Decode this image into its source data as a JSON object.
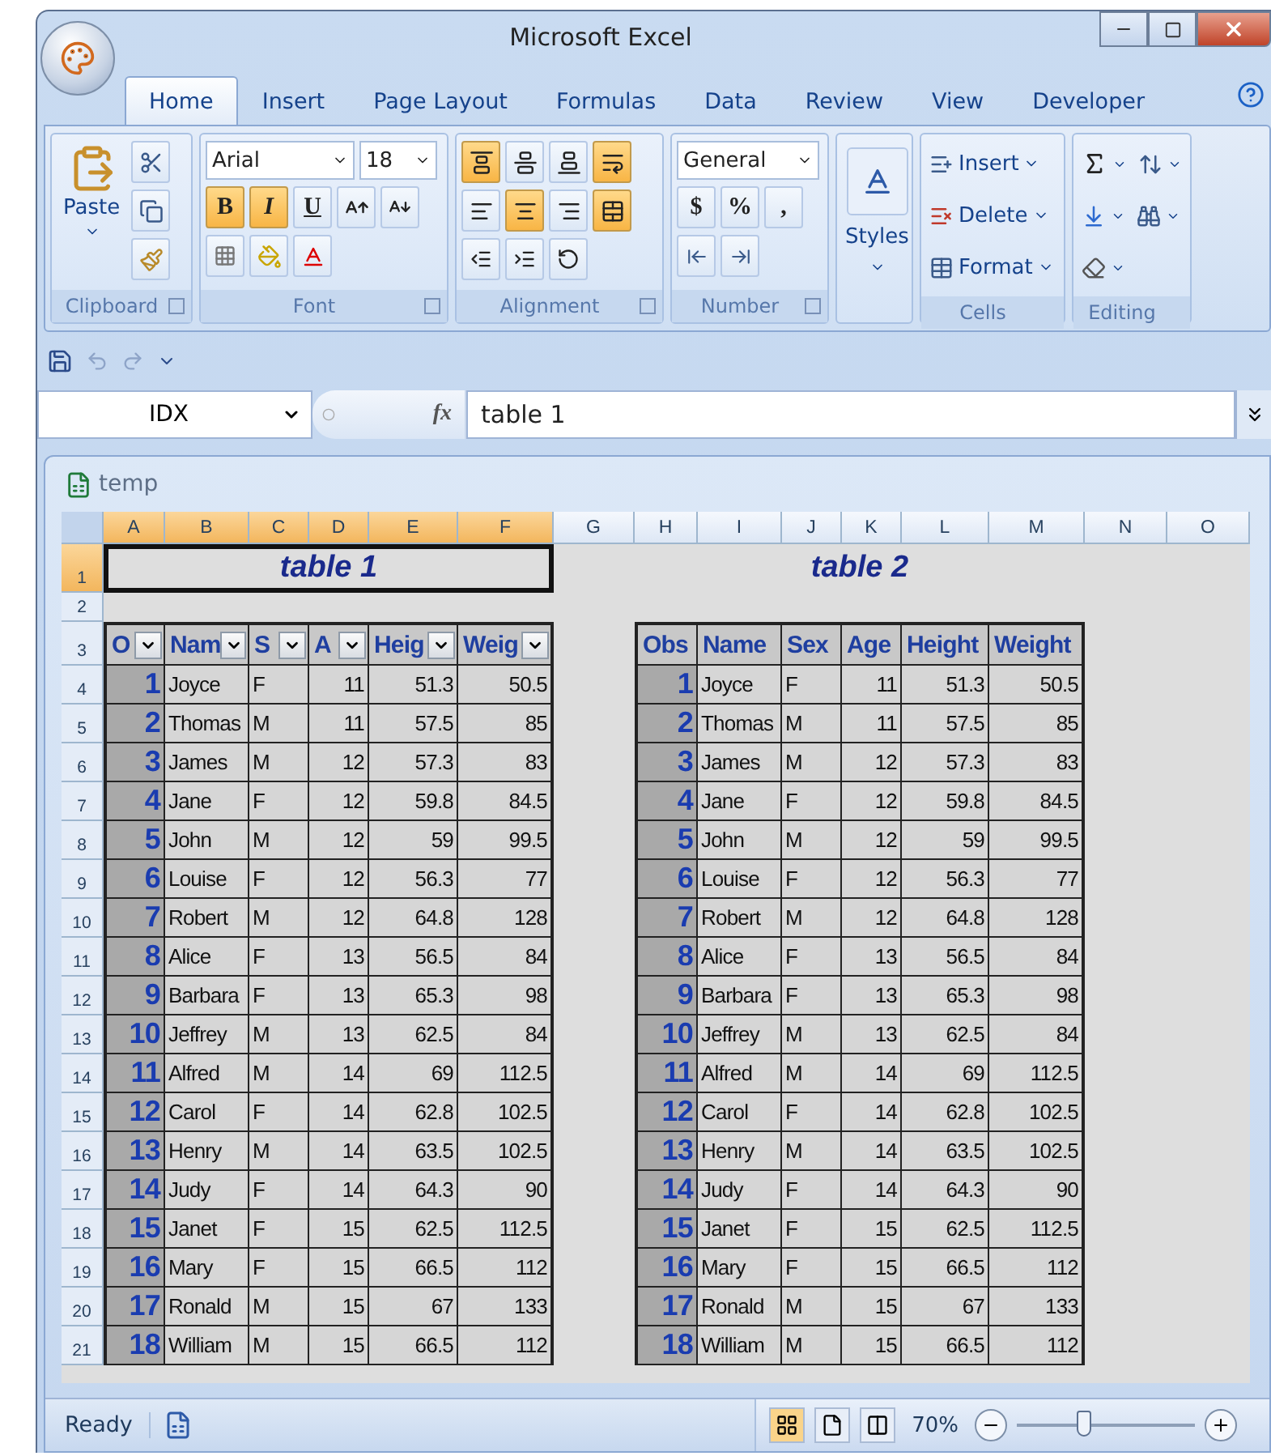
{
  "window": {
    "title": "Microsoft Excel"
  },
  "ribbon": {
    "tabs": [
      {
        "label": "Home",
        "selected": true
      },
      {
        "label": "Insert",
        "selected": false
      },
      {
        "label": "Page Layout",
        "selected": false
      },
      {
        "label": "Formulas",
        "selected": false
      },
      {
        "label": "Data",
        "selected": false
      },
      {
        "label": "Review",
        "selected": false
      },
      {
        "label": "View",
        "selected": false
      },
      {
        "label": "Developer",
        "selected": false
      }
    ],
    "clipboard": {
      "paste": "Paste",
      "label": "Clipboard"
    },
    "font": {
      "name": "Arial",
      "size": "18",
      "label": "Font",
      "styles": [
        {
          "label": "B",
          "on": true
        },
        {
          "label": "I",
          "on": true
        },
        {
          "label": "U",
          "on": false
        }
      ]
    },
    "alignment": {
      "label": "Alignment",
      "vertical": [
        {
          "kind": "top",
          "on": true
        },
        {
          "kind": "middle",
          "on": false
        },
        {
          "kind": "bottom",
          "on": false
        }
      ],
      "horizontal": [
        {
          "kind": "left",
          "on": false
        },
        {
          "kind": "center",
          "on": true
        },
        {
          "kind": "right",
          "on": false
        }
      ],
      "wrap_on": true,
      "merge_on": true
    },
    "number": {
      "format": "General",
      "symbols": [
        "$",
        "%",
        ","
      ],
      "label": "Number"
    },
    "styles": {
      "label": "Styles"
    },
    "cells": {
      "buttons": [
        {
          "kind": "insert",
          "label": "Insert"
        },
        {
          "kind": "delete",
          "label": "Delete"
        },
        {
          "kind": "format",
          "label": "Format"
        }
      ],
      "label": "Cells"
    },
    "editing": {
      "label": "Editing"
    }
  },
  "formula_bar": {
    "name_box": "IDX",
    "fx": "fx",
    "value": "table 1"
  },
  "workbook": {
    "title": "temp",
    "columns": [
      {
        "label": "A",
        "selected": true
      },
      {
        "label": "B",
        "selected": true
      },
      {
        "label": "C",
        "selected": true
      },
      {
        "label": "D",
        "selected": true
      },
      {
        "label": "E",
        "selected": true
      },
      {
        "label": "F",
        "selected": true
      },
      {
        "label": "G",
        "selected": false
      },
      {
        "label": "H",
        "selected": false
      },
      {
        "label": "I",
        "selected": false
      },
      {
        "label": "J",
        "selected": false
      },
      {
        "label": "K",
        "selected": false
      },
      {
        "label": "L",
        "selected": false
      },
      {
        "label": "M",
        "selected": false
      },
      {
        "label": "N",
        "selected": false
      },
      {
        "label": "O",
        "selected": false
      }
    ],
    "row_numbers": [
      {
        "label": "1",
        "selected": true
      },
      {
        "label": "2",
        "selected": false
      },
      {
        "label": "3",
        "selected": false
      },
      {
        "label": "4",
        "selected": false
      },
      {
        "label": "5",
        "selected": false
      },
      {
        "label": "6",
        "selected": false
      },
      {
        "label": "7",
        "selected": false
      },
      {
        "label": "8",
        "selected": false
      },
      {
        "label": "9",
        "selected": false
      },
      {
        "label": "10",
        "selected": false
      },
      {
        "label": "11",
        "selected": false
      },
      {
        "label": "12",
        "selected": false
      },
      {
        "label": "13",
        "selected": false
      },
      {
        "label": "14",
        "selected": false
      },
      {
        "label": "15",
        "selected": false
      },
      {
        "label": "16",
        "selected": false
      },
      {
        "label": "17",
        "selected": false
      },
      {
        "label": "18",
        "selected": false
      },
      {
        "label": "19",
        "selected": false
      },
      {
        "label": "20",
        "selected": false
      },
      {
        "label": "21",
        "selected": false
      }
    ],
    "tables": [
      {
        "title": "table 1",
        "selected": true,
        "filters": true,
        "headers": [
          "O",
          "Nam",
          "S",
          "A",
          "Heig",
          "Weig"
        ],
        "rows": [
          [
            "1",
            "Joyce",
            "F",
            "11",
            "51.3",
            "50.5"
          ],
          [
            "2",
            "Thomas",
            "M",
            "11",
            "57.5",
            "85"
          ],
          [
            "3",
            "James",
            "M",
            "12",
            "57.3",
            "83"
          ],
          [
            "4",
            "Jane",
            "F",
            "12",
            "59.8",
            "84.5"
          ],
          [
            "5",
            "John",
            "M",
            "12",
            "59",
            "99.5"
          ],
          [
            "6",
            "Louise",
            "F",
            "12",
            "56.3",
            "77"
          ],
          [
            "7",
            "Robert",
            "M",
            "12",
            "64.8",
            "128"
          ],
          [
            "8",
            "Alice",
            "F",
            "13",
            "56.5",
            "84"
          ],
          [
            "9",
            "Barbara",
            "F",
            "13",
            "65.3",
            "98"
          ],
          [
            "10",
            "Jeffrey",
            "M",
            "13",
            "62.5",
            "84"
          ],
          [
            "11",
            "Alfred",
            "M",
            "14",
            "69",
            "112.5"
          ],
          [
            "12",
            "Carol",
            "F",
            "14",
            "62.8",
            "102.5"
          ],
          [
            "13",
            "Henry",
            "M",
            "14",
            "63.5",
            "102.5"
          ],
          [
            "14",
            "Judy",
            "F",
            "14",
            "64.3",
            "90"
          ],
          [
            "15",
            "Janet",
            "F",
            "15",
            "62.5",
            "112.5"
          ],
          [
            "16",
            "Mary",
            "F",
            "15",
            "66.5",
            "112"
          ],
          [
            "17",
            "Ronald",
            "M",
            "15",
            "67",
            "133"
          ],
          [
            "18",
            "William",
            "M",
            "15",
            "66.5",
            "112"
          ]
        ]
      },
      {
        "title": "table 2",
        "selected": false,
        "filters": false,
        "headers": [
          "Obs",
          "Name",
          "Sex",
          "Age",
          "Height",
          "Weight"
        ],
        "rows": [
          [
            "1",
            "Joyce",
            "F",
            "11",
            "51.3",
            "50.5"
          ],
          [
            "2",
            "Thomas",
            "M",
            "11",
            "57.5",
            "85"
          ],
          [
            "3",
            "James",
            "M",
            "12",
            "57.3",
            "83"
          ],
          [
            "4",
            "Jane",
            "F",
            "12",
            "59.8",
            "84.5"
          ],
          [
            "5",
            "John",
            "M",
            "12",
            "59",
            "99.5"
          ],
          [
            "6",
            "Louise",
            "F",
            "12",
            "56.3",
            "77"
          ],
          [
            "7",
            "Robert",
            "M",
            "12",
            "64.8",
            "128"
          ],
          [
            "8",
            "Alice",
            "F",
            "13",
            "56.5",
            "84"
          ],
          [
            "9",
            "Barbara",
            "F",
            "13",
            "65.3",
            "98"
          ],
          [
            "10",
            "Jeffrey",
            "M",
            "13",
            "62.5",
            "84"
          ],
          [
            "11",
            "Alfred",
            "M",
            "14",
            "69",
            "112.5"
          ],
          [
            "12",
            "Carol",
            "F",
            "14",
            "62.8",
            "102.5"
          ],
          [
            "13",
            "Henry",
            "M",
            "14",
            "63.5",
            "102.5"
          ],
          [
            "14",
            "Judy",
            "F",
            "14",
            "64.3",
            "90"
          ],
          [
            "15",
            "Janet",
            "F",
            "15",
            "62.5",
            "112.5"
          ],
          [
            "16",
            "Mary",
            "F",
            "15",
            "66.5",
            "112"
          ],
          [
            "17",
            "Ronald",
            "M",
            "15",
            "67",
            "133"
          ],
          [
            "18",
            "William",
            "M",
            "15",
            "66.5",
            "112"
          ]
        ]
      }
    ]
  },
  "status_bar": {
    "status": "Ready",
    "zoom": "70%",
    "zoom_level": {
      "level": 0.37
    }
  }
}
